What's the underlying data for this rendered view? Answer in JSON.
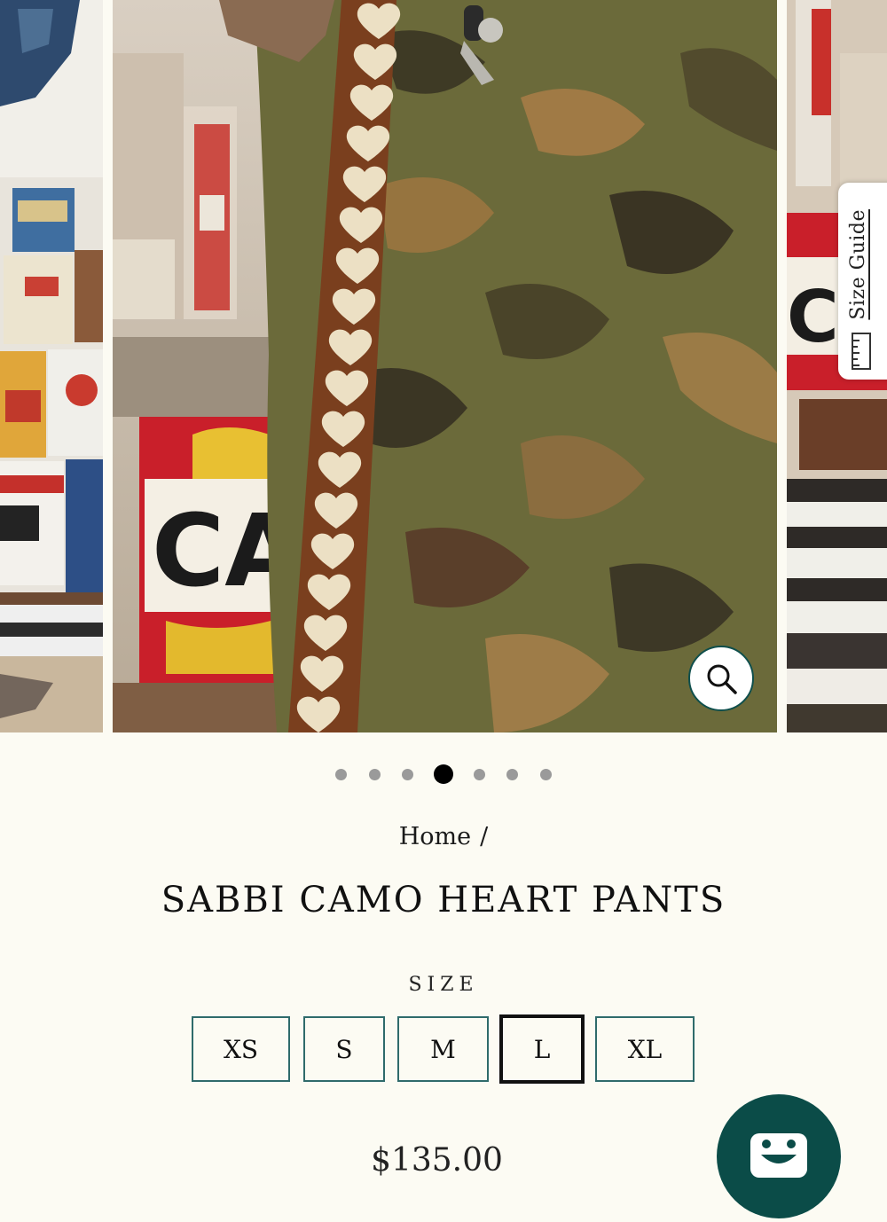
{
  "gallery": {
    "slides": [
      {
        "icon": "shop-shelves-image"
      },
      {
        "icon": "camo-heart-pants-image"
      },
      {
        "icon": "garage-signs-image"
      }
    ],
    "zoom_icon": "magnifier-icon",
    "size_guide": {
      "label": "Size Guide",
      "icon": "ruler-icon"
    },
    "dots_count": 7,
    "active_dot": 4
  },
  "breadcrumb": {
    "home": "Home",
    "separator": "/"
  },
  "product": {
    "title": "SABBI CAMO HEART PANTS",
    "size_label": "SIZE",
    "sizes": [
      "XS",
      "S",
      "M",
      "L",
      "XL"
    ],
    "selected_size": "L",
    "price": "$135.00"
  },
  "chat": {
    "icon": "smiley-chat-icon"
  },
  "colors": {
    "background": "#fcfbf3",
    "accent_teal": "#0b4c48",
    "size_border": "#2f6b6b",
    "selected_border": "#111111"
  }
}
